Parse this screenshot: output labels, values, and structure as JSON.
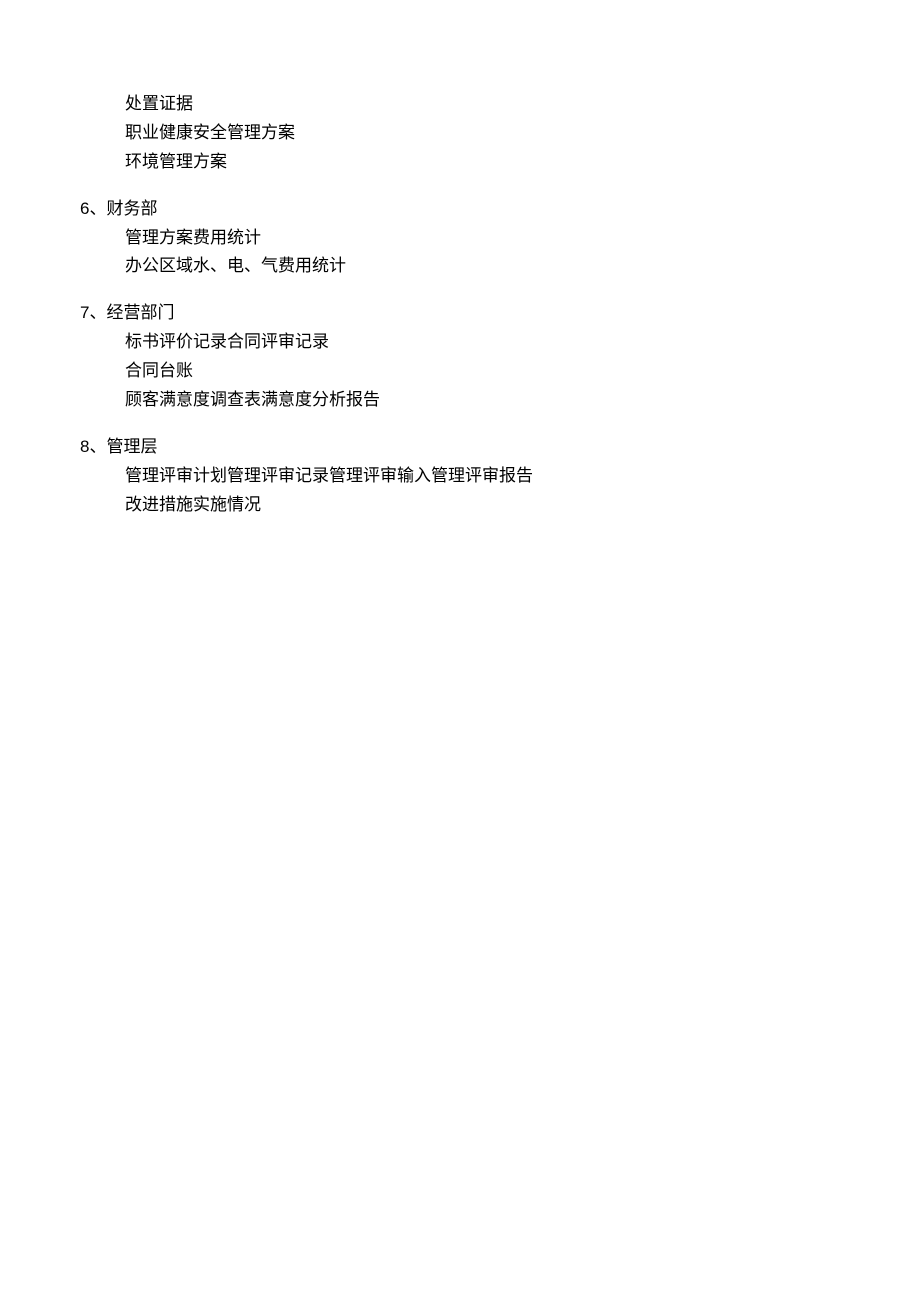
{
  "orphan_section": {
    "items": [
      "处置证据",
      "职业健康安全管理方案",
      "环境管理方案"
    ]
  },
  "sections": [
    {
      "number": "6、",
      "title": "财务部",
      "items": [
        "管理方案费用统计",
        "办公区域水、电、气费用统计"
      ]
    },
    {
      "number": "7、",
      "title": "经营部门",
      "items": [
        "标书评价记录合同评审记录",
        "合同台账",
        "顾客满意度调查表满意度分析报告"
      ]
    },
    {
      "number": "8、",
      "title": "管理层",
      "items": [
        "管理评审计划管理评审记录管理评审输入管理评审报告",
        "改进措施实施情况"
      ]
    }
  ]
}
